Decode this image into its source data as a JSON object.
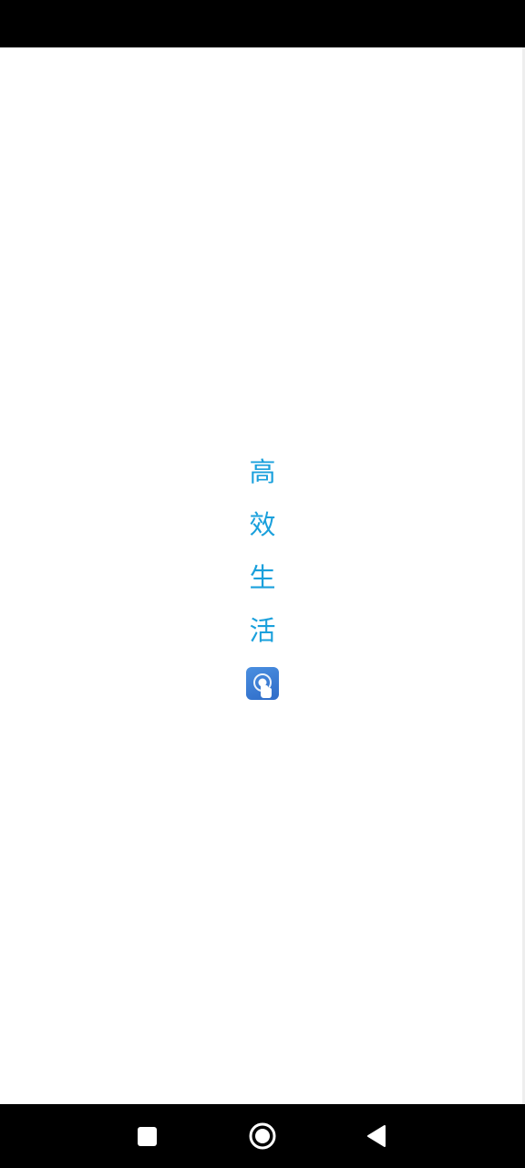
{
  "colors": {
    "accent": "#1aa0dc",
    "status_bar": "#000000",
    "nav_bar": "#000000",
    "background": "#ffffff",
    "icon_tile": "#3a7ad6"
  },
  "slogan": {
    "chars": [
      "高",
      "效",
      "生",
      "活"
    ]
  },
  "app_icon": {
    "name": "pointer-tap-icon"
  },
  "nav": {
    "recent_icon": "square-recents-icon",
    "home_icon": "circle-home-icon",
    "back_icon": "triangle-back-icon"
  }
}
